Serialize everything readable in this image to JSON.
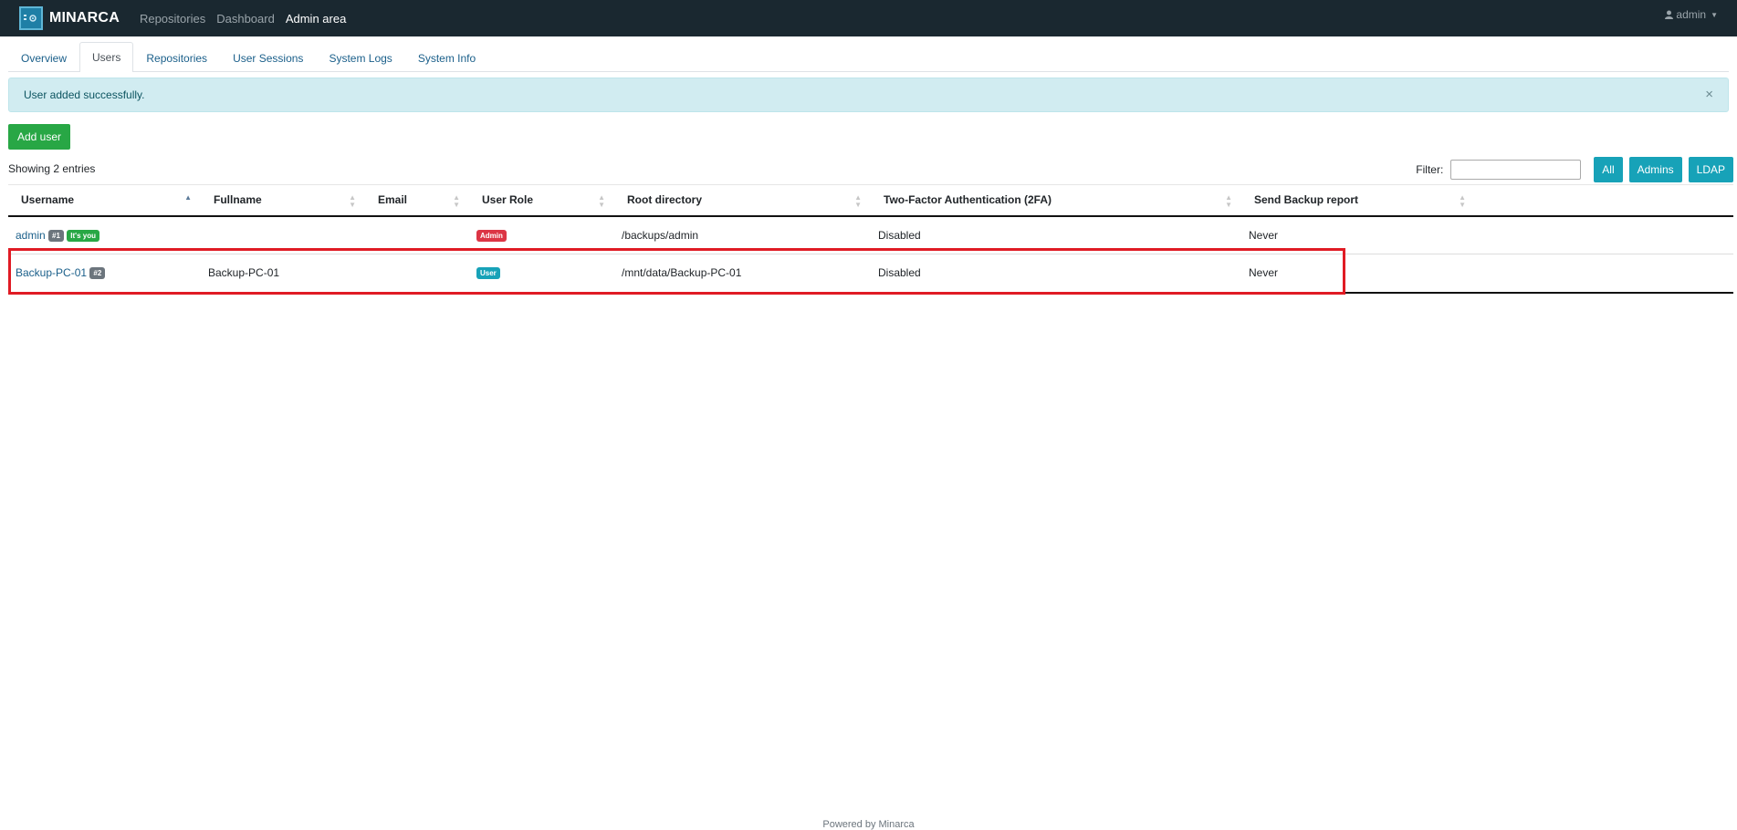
{
  "navbar": {
    "brand": "MINARCA",
    "links": [
      "Repositories",
      "Dashboard",
      "Admin area"
    ],
    "user": "admin"
  },
  "tabs": [
    "Overview",
    "Users",
    "Repositories",
    "User Sessions",
    "System Logs",
    "System Info"
  ],
  "alert": {
    "message": "User added successfully.",
    "close": "×"
  },
  "add_user_label": "Add user",
  "showing_text": "Showing 2 entries",
  "filter": {
    "label": "Filter:",
    "value": "",
    "buttons": [
      "All",
      "Admins",
      "LDAP"
    ]
  },
  "table": {
    "headers": [
      "Username",
      "Fullname",
      "Email",
      "User Role",
      "Root directory",
      "Two-Factor Authentication (2FA)",
      "Send Backup report"
    ],
    "rows": [
      {
        "username": "admin",
        "id_badge": "#1",
        "you_badge": "It's you",
        "fullname": "",
        "email": "",
        "role": "Admin",
        "root": "/backups/admin",
        "twofa": "Disabled",
        "report": "Never"
      },
      {
        "username": "Backup-PC-01",
        "id_badge": "#2",
        "fullname": "Backup-PC-01",
        "email": "",
        "role": "User",
        "root": "/mnt/data/Backup-PC-01",
        "twofa": "Disabled",
        "report": "Never"
      }
    ]
  },
  "footer": "Powered by Minarca",
  "colors": {
    "navbar": "#1a2830",
    "success": "#28a745",
    "info": "#17a2b8",
    "danger": "#dc3545",
    "highlight": "#e01b24"
  }
}
